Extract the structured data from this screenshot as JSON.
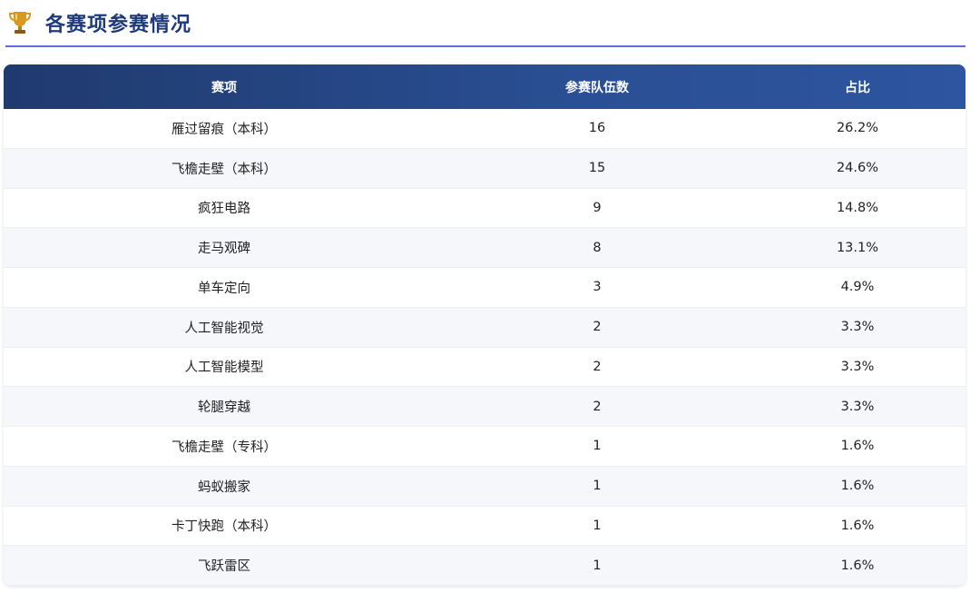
{
  "header": {
    "icon": "trophy-icon",
    "title": "各赛项参赛情况"
  },
  "colors": {
    "title": "#1f3a7a",
    "underline": "#5b6fd6",
    "table_header_start": "#1f3a6e",
    "table_header_end": "#2d55a0",
    "trophy": "#c9911e"
  },
  "table": {
    "columns": [
      "赛项",
      "参赛队伍数",
      "占比"
    ],
    "rows": [
      {
        "event": "雁过留痕（本科）",
        "teams": "16",
        "ratio": "26.2%"
      },
      {
        "event": "飞檐走壁（本科）",
        "teams": "15",
        "ratio": "24.6%"
      },
      {
        "event": "疯狂电路",
        "teams": "9",
        "ratio": "14.8%"
      },
      {
        "event": "走马观碑",
        "teams": "8",
        "ratio": "13.1%"
      },
      {
        "event": "单车定向",
        "teams": "3",
        "ratio": "4.9%"
      },
      {
        "event": "人工智能视觉",
        "teams": "2",
        "ratio": "3.3%"
      },
      {
        "event": "人工智能模型",
        "teams": "2",
        "ratio": "3.3%"
      },
      {
        "event": "轮腿穿越",
        "teams": "2",
        "ratio": "3.3%"
      },
      {
        "event": "飞檐走壁（专科）",
        "teams": "1",
        "ratio": "1.6%"
      },
      {
        "event": "蚂蚁搬家",
        "teams": "1",
        "ratio": "1.6%"
      },
      {
        "event": "卡丁快跑（本科）",
        "teams": "1",
        "ratio": "1.6%"
      },
      {
        "event": "飞跃雷区",
        "teams": "1",
        "ratio": "1.6%"
      }
    ]
  }
}
